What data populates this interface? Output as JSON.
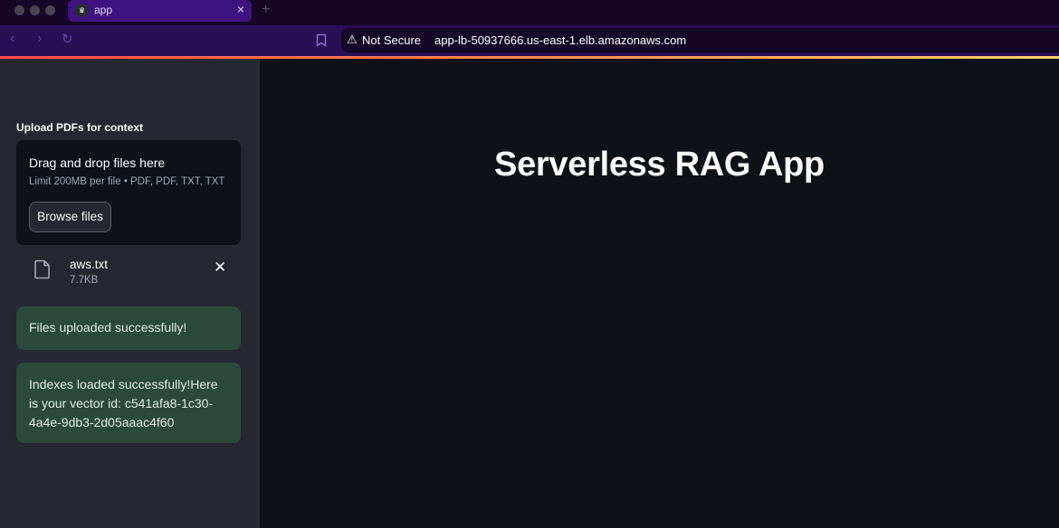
{
  "browser": {
    "tab": {
      "title": "app",
      "favicon": "streamlit-crown-icon",
      "close": "×"
    },
    "new_tab": "+",
    "nav": {
      "back": "‹",
      "forward": "›",
      "reload": "↻"
    },
    "security_warning_icon": "⚠",
    "security_label": "Not Secure",
    "url": "app-lb-50937666.us-east-1.elb.amazonaws.com"
  },
  "sidebar": {
    "uploader": {
      "label": "Upload PDFs for context",
      "dropzone_title": "Drag and drop files here",
      "dropzone_limit": "Limit 200MB per file • PDF, PDF, TXT, TXT",
      "browse_label": "Browse files"
    },
    "files": [
      {
        "name": "aws.txt",
        "size": "7.7KB",
        "remove": "✕"
      }
    ],
    "alerts": [
      {
        "text": "Files uploaded successfully!",
        "type": "success"
      },
      {
        "text": "Indexes loaded successfully!Here is your vector id: c541afa8-1c30-4a4e-9db3-2d05aaac4f60",
        "type": "success"
      }
    ]
  },
  "main": {
    "title": "Serverless RAG App"
  }
}
